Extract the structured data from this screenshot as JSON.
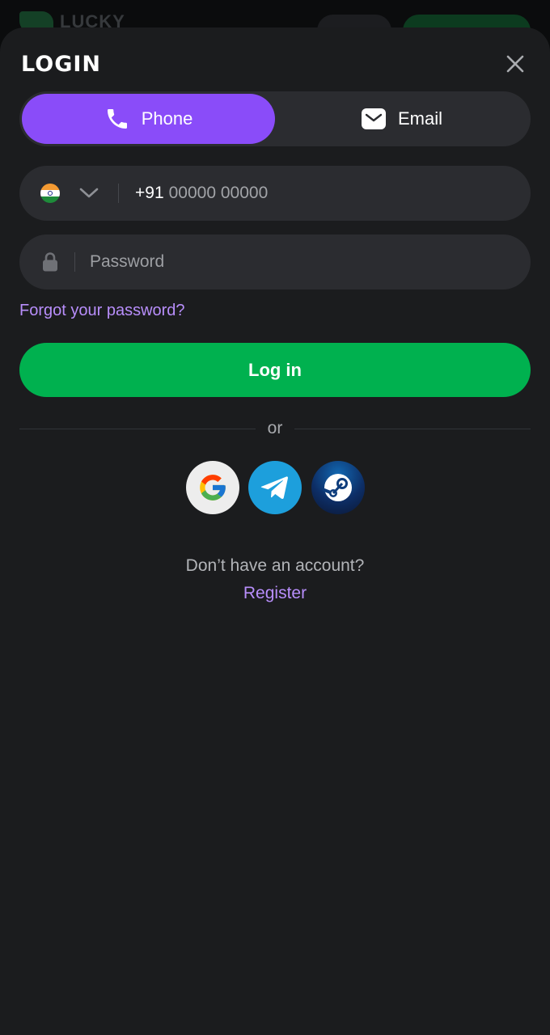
{
  "background": {
    "logo_text": "LUCKY"
  },
  "modal": {
    "title": "LOGIN",
    "close_icon": "close-icon"
  },
  "tabs": [
    {
      "label": "Phone",
      "icon": "phone-icon",
      "active": true
    },
    {
      "label": "Email",
      "icon": "mail-icon",
      "active": false
    }
  ],
  "phone_field": {
    "country_flag": "india-flag-icon",
    "dropdown_icon": "chevron-down-icon",
    "prefix": "+91",
    "placeholder": "00000 00000",
    "value": ""
  },
  "password_field": {
    "icon": "lock-icon",
    "placeholder": "Password",
    "value": ""
  },
  "forgot_link": "Forgot your password?",
  "login_button": "Log in",
  "divider_text": "or",
  "social_logins": [
    {
      "name": "google",
      "icon": "google-icon"
    },
    {
      "name": "telegram",
      "icon": "telegram-icon"
    },
    {
      "name": "steam",
      "icon": "steam-icon"
    }
  ],
  "signup_prompt": "Don’t have an account?",
  "register_link": "Register",
  "colors": {
    "accent_purple": "#8a4cf9",
    "link_purple": "#b88efb",
    "login_green": "#00b14f",
    "sheet_bg": "#1b1c1e",
    "field_bg": "#2b2c30"
  }
}
